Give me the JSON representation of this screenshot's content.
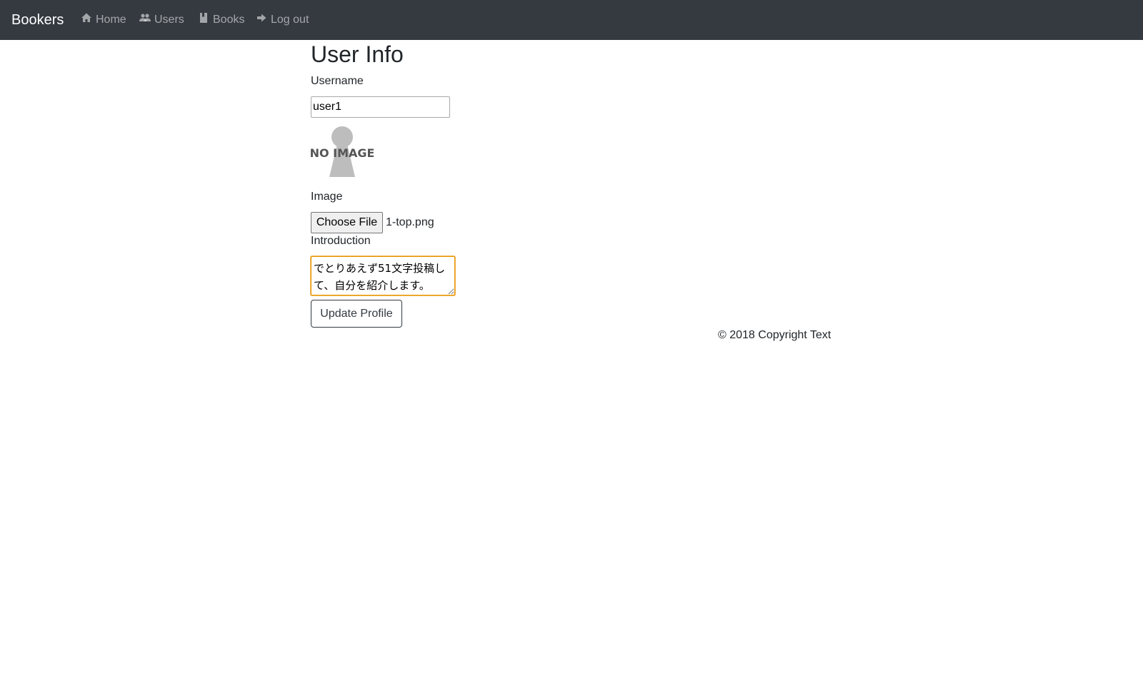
{
  "navbar": {
    "brand": "Bookers",
    "links": [
      {
        "label": "Home",
        "icon": "home-icon"
      },
      {
        "label": "Users",
        "icon": "users-icon"
      },
      {
        "label": "Books",
        "icon": "book-icon"
      },
      {
        "label": "Log out",
        "icon": "logout-icon"
      }
    ],
    "background": "#343a40"
  },
  "main": {
    "title": "User Info",
    "username": {
      "label": "Username",
      "value": "user1"
    },
    "profile_image": {
      "placeholder_text": "NO IMAGE"
    },
    "image": {
      "label": "Image",
      "button_label": "Choose File",
      "file_name": "1-top.png"
    },
    "introduction": {
      "label": "Introduction",
      "value": "でとりあえず51文字投稿して、自分を紹介します。"
    },
    "submit_label": "Update Profile"
  },
  "footer": {
    "text": "© 2018 Copyright Text"
  }
}
